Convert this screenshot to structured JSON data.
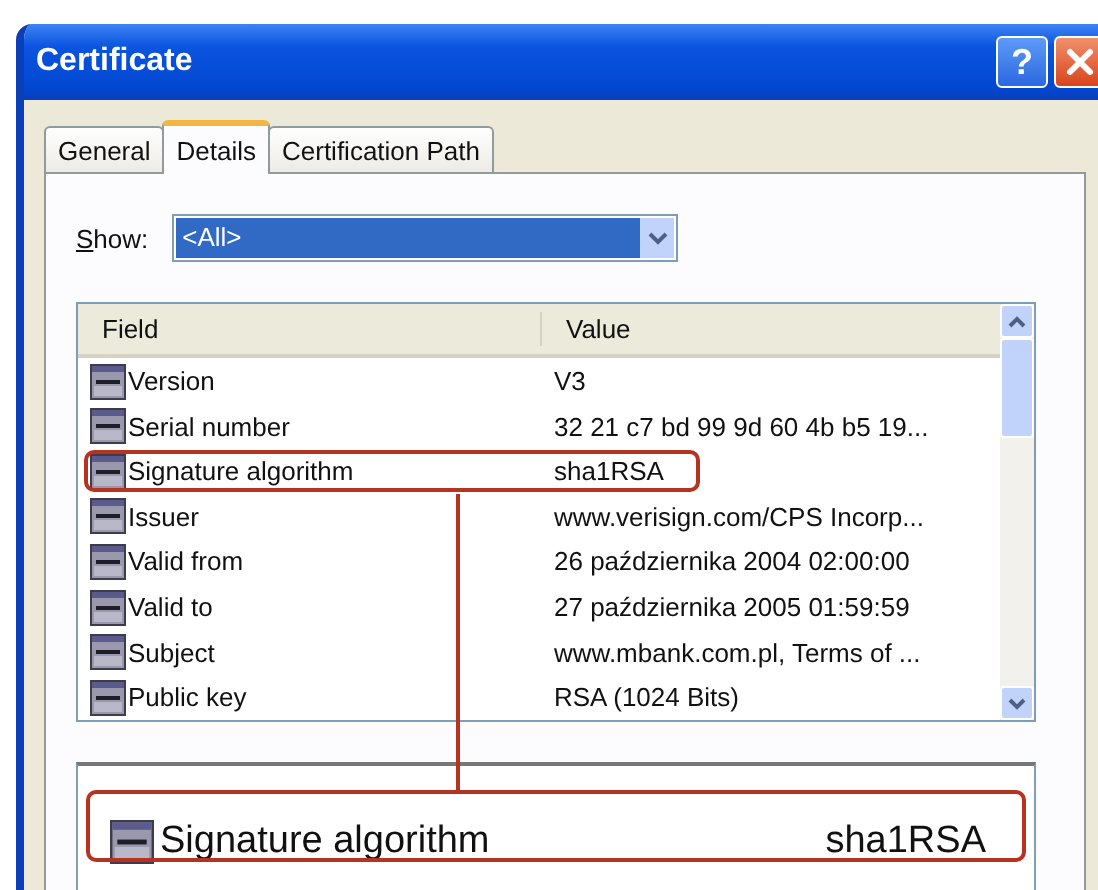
{
  "window": {
    "title": "Certificate",
    "help": "?"
  },
  "tabs": [
    {
      "label": "General",
      "selected": false
    },
    {
      "label": "Details",
      "selected": true
    },
    {
      "label": "Certification Path",
      "selected": false
    }
  ],
  "show": {
    "label": "Show:",
    "value": "<All>"
  },
  "table": {
    "columns": [
      "Field",
      "Value"
    ],
    "rows": [
      {
        "field": "Version",
        "value": "V3",
        "highlighted": false
      },
      {
        "field": "Serial number",
        "value": "32 21 c7 bd 99 9d 60 4b b5 19...",
        "highlighted": false
      },
      {
        "field": "Signature algorithm",
        "value": "sha1RSA",
        "highlighted": true
      },
      {
        "field": "Issuer",
        "value": "www.verisign.com/CPS Incorp...",
        "highlighted": false
      },
      {
        "field": "Valid from",
        "value": "26 października 2004 02:00:00",
        "highlighted": false
      },
      {
        "field": "Valid to",
        "value": "27 października 2005 01:59:59",
        "highlighted": false
      },
      {
        "field": "Subject",
        "value": "www.mbank.com.pl, Terms of ...",
        "highlighted": false
      },
      {
        "field": "Public key",
        "value": "RSA (1024 Bits)",
        "highlighted": false
      }
    ]
  },
  "detail": {
    "field": "Signature algorithm",
    "value": "sha1RSA",
    "highlighted": true
  }
}
